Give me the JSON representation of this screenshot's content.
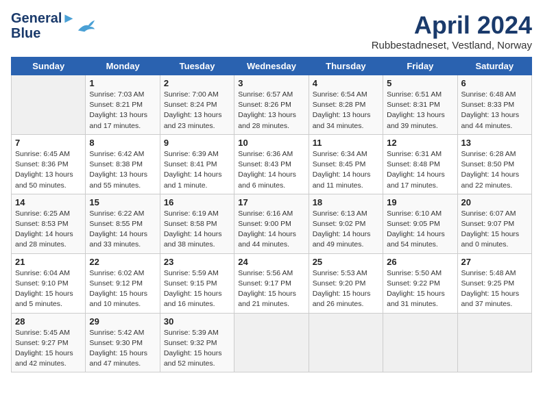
{
  "header": {
    "logo_line1": "General",
    "logo_line2": "Blue",
    "month_title": "April 2024",
    "location": "Rubbestadneset, Vestland, Norway"
  },
  "days_of_week": [
    "Sunday",
    "Monday",
    "Tuesday",
    "Wednesday",
    "Thursday",
    "Friday",
    "Saturday"
  ],
  "weeks": [
    [
      {
        "num": "",
        "empty": true
      },
      {
        "num": "1",
        "sunrise": "Sunrise: 7:03 AM",
        "sunset": "Sunset: 8:21 PM",
        "daylight": "Daylight: 13 hours and 17 minutes."
      },
      {
        "num": "2",
        "sunrise": "Sunrise: 7:00 AM",
        "sunset": "Sunset: 8:24 PM",
        "daylight": "Daylight: 13 hours and 23 minutes."
      },
      {
        "num": "3",
        "sunrise": "Sunrise: 6:57 AM",
        "sunset": "Sunset: 8:26 PM",
        "daylight": "Daylight: 13 hours and 28 minutes."
      },
      {
        "num": "4",
        "sunrise": "Sunrise: 6:54 AM",
        "sunset": "Sunset: 8:28 PM",
        "daylight": "Daylight: 13 hours and 34 minutes."
      },
      {
        "num": "5",
        "sunrise": "Sunrise: 6:51 AM",
        "sunset": "Sunset: 8:31 PM",
        "daylight": "Daylight: 13 hours and 39 minutes."
      },
      {
        "num": "6",
        "sunrise": "Sunrise: 6:48 AM",
        "sunset": "Sunset: 8:33 PM",
        "daylight": "Daylight: 13 hours and 44 minutes."
      }
    ],
    [
      {
        "num": "7",
        "sunrise": "Sunrise: 6:45 AM",
        "sunset": "Sunset: 8:36 PM",
        "daylight": "Daylight: 13 hours and 50 minutes."
      },
      {
        "num": "8",
        "sunrise": "Sunrise: 6:42 AM",
        "sunset": "Sunset: 8:38 PM",
        "daylight": "Daylight: 13 hours and 55 minutes."
      },
      {
        "num": "9",
        "sunrise": "Sunrise: 6:39 AM",
        "sunset": "Sunset: 8:41 PM",
        "daylight": "Daylight: 14 hours and 1 minute."
      },
      {
        "num": "10",
        "sunrise": "Sunrise: 6:36 AM",
        "sunset": "Sunset: 8:43 PM",
        "daylight": "Daylight: 14 hours and 6 minutes."
      },
      {
        "num": "11",
        "sunrise": "Sunrise: 6:34 AM",
        "sunset": "Sunset: 8:45 PM",
        "daylight": "Daylight: 14 hours and 11 minutes."
      },
      {
        "num": "12",
        "sunrise": "Sunrise: 6:31 AM",
        "sunset": "Sunset: 8:48 PM",
        "daylight": "Daylight: 14 hours and 17 minutes."
      },
      {
        "num": "13",
        "sunrise": "Sunrise: 6:28 AM",
        "sunset": "Sunset: 8:50 PM",
        "daylight": "Daylight: 14 hours and 22 minutes."
      }
    ],
    [
      {
        "num": "14",
        "sunrise": "Sunrise: 6:25 AM",
        "sunset": "Sunset: 8:53 PM",
        "daylight": "Daylight: 14 hours and 28 minutes."
      },
      {
        "num": "15",
        "sunrise": "Sunrise: 6:22 AM",
        "sunset": "Sunset: 8:55 PM",
        "daylight": "Daylight: 14 hours and 33 minutes."
      },
      {
        "num": "16",
        "sunrise": "Sunrise: 6:19 AM",
        "sunset": "Sunset: 8:58 PM",
        "daylight": "Daylight: 14 hours and 38 minutes."
      },
      {
        "num": "17",
        "sunrise": "Sunrise: 6:16 AM",
        "sunset": "Sunset: 9:00 PM",
        "daylight": "Daylight: 14 hours and 44 minutes."
      },
      {
        "num": "18",
        "sunrise": "Sunrise: 6:13 AM",
        "sunset": "Sunset: 9:02 PM",
        "daylight": "Daylight: 14 hours and 49 minutes."
      },
      {
        "num": "19",
        "sunrise": "Sunrise: 6:10 AM",
        "sunset": "Sunset: 9:05 PM",
        "daylight": "Daylight: 14 hours and 54 minutes."
      },
      {
        "num": "20",
        "sunrise": "Sunrise: 6:07 AM",
        "sunset": "Sunset: 9:07 PM",
        "daylight": "Daylight: 15 hours and 0 minutes."
      }
    ],
    [
      {
        "num": "21",
        "sunrise": "Sunrise: 6:04 AM",
        "sunset": "Sunset: 9:10 PM",
        "daylight": "Daylight: 15 hours and 5 minutes."
      },
      {
        "num": "22",
        "sunrise": "Sunrise: 6:02 AM",
        "sunset": "Sunset: 9:12 PM",
        "daylight": "Daylight: 15 hours and 10 minutes."
      },
      {
        "num": "23",
        "sunrise": "Sunrise: 5:59 AM",
        "sunset": "Sunset: 9:15 PM",
        "daylight": "Daylight: 15 hours and 16 minutes."
      },
      {
        "num": "24",
        "sunrise": "Sunrise: 5:56 AM",
        "sunset": "Sunset: 9:17 PM",
        "daylight": "Daylight: 15 hours and 21 minutes."
      },
      {
        "num": "25",
        "sunrise": "Sunrise: 5:53 AM",
        "sunset": "Sunset: 9:20 PM",
        "daylight": "Daylight: 15 hours and 26 minutes."
      },
      {
        "num": "26",
        "sunrise": "Sunrise: 5:50 AM",
        "sunset": "Sunset: 9:22 PM",
        "daylight": "Daylight: 15 hours and 31 minutes."
      },
      {
        "num": "27",
        "sunrise": "Sunrise: 5:48 AM",
        "sunset": "Sunset: 9:25 PM",
        "daylight": "Daylight: 15 hours and 37 minutes."
      }
    ],
    [
      {
        "num": "28",
        "sunrise": "Sunrise: 5:45 AM",
        "sunset": "Sunset: 9:27 PM",
        "daylight": "Daylight: 15 hours and 42 minutes."
      },
      {
        "num": "29",
        "sunrise": "Sunrise: 5:42 AM",
        "sunset": "Sunset: 9:30 PM",
        "daylight": "Daylight: 15 hours and 47 minutes."
      },
      {
        "num": "30",
        "sunrise": "Sunrise: 5:39 AM",
        "sunset": "Sunset: 9:32 PM",
        "daylight": "Daylight: 15 hours and 52 minutes."
      },
      {
        "num": "",
        "empty": true
      },
      {
        "num": "",
        "empty": true
      },
      {
        "num": "",
        "empty": true
      },
      {
        "num": "",
        "empty": true
      }
    ]
  ]
}
